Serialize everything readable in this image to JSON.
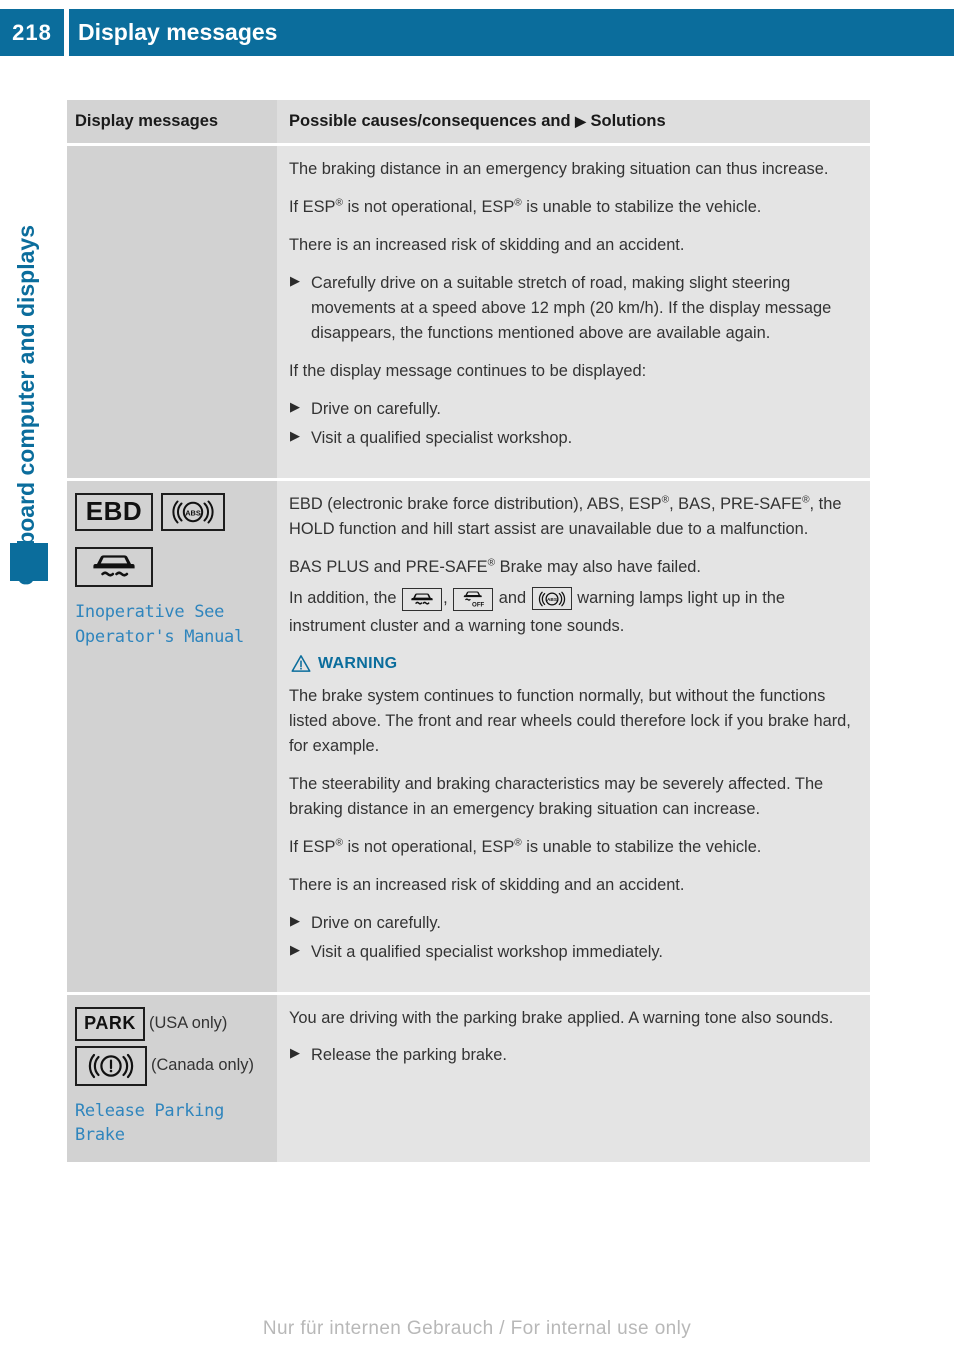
{
  "header": {
    "page_number": "218",
    "title": "Display messages",
    "bar_color": "#0b6d9c"
  },
  "sidebar": {
    "chapter_label": "On-board computer and displays",
    "marker_color": "#0b6d9c"
  },
  "table": {
    "columns": {
      "left": "Display messages",
      "right_before_arrow": "Possible causes/consequences and",
      "right_arrow": "▶",
      "right_after_arrow": "Solutions"
    },
    "rows": [
      {
        "left": {
          "symbols": [],
          "message": ""
        },
        "right": {
          "paragraphs": [
            "The braking distance in an emergency braking situation can thus increase.",
            "If ESP® is not operational, ESP® is unable to stabilize the vehicle.",
            "There is an increased risk of skidding and an accident."
          ],
          "bullets_1": [
            "Carefully drive on a suitable stretch of road, making slight steering movements at a speed above 12 mph (20 km/h). If the display message disappears, the functions mentioned above are available again."
          ],
          "paragraph_mid": "If the display message continues to be displayed:",
          "bullets_2": [
            "Drive on carefully.",
            "Visit a qualified specialist workshop."
          ]
        }
      },
      {
        "left": {
          "symbol_ebd": "EBD",
          "symbol_abs_label": "ABS",
          "symbol_skid_name": "car-skid",
          "message": "Inoperative See Operator's Manual"
        },
        "right": {
          "para_1": "EBD (electronic brake force distribution), ABS, ESP®, BAS, PRE-SAFE®, the HOLD function and hill start assist are unavailable due to a malfunction.",
          "para_2": "BAS PLUS and PRE-SAFE® Brake may also have failed.",
          "para_3_a": "In addition, the",
          "para_3_b": ",",
          "para_3_c": "and",
          "para_3_d": "warning lamps light up in the instrument cluster and a warning tone sounds.",
          "warning_title": "WARNING",
          "warning_color": "#0b6d9c",
          "warning_paragraphs": [
            "The brake system continues to function normally, but without the functions listed above. The front and rear wheels could therefore lock if you brake hard, for example.",
            "The steerability and braking characteristics may be severely affected. The braking distance in an emergency braking situation can increase.",
            "If ESP® is not operational, ESP® is unable to stabilize the vehicle.",
            "There is an increased risk of skidding and an accident."
          ],
          "bullets": [
            "Drive on carefully.",
            "Visit a qualified specialist workshop immediately."
          ]
        }
      },
      {
        "left": {
          "symbol_park": "PARK",
          "note_usa": "(USA only)",
          "note_canada": "(Canada only)",
          "message": "Release Parking Brake"
        },
        "right": {
          "paragraphs": [
            "You are driving with the parking brake applied. A warning tone also sounds."
          ],
          "bullets": [
            "Release the parking brake."
          ]
        }
      }
    ]
  },
  "footer": {
    "watermark": "Nur für internen Gebrauch / For internal use only"
  }
}
